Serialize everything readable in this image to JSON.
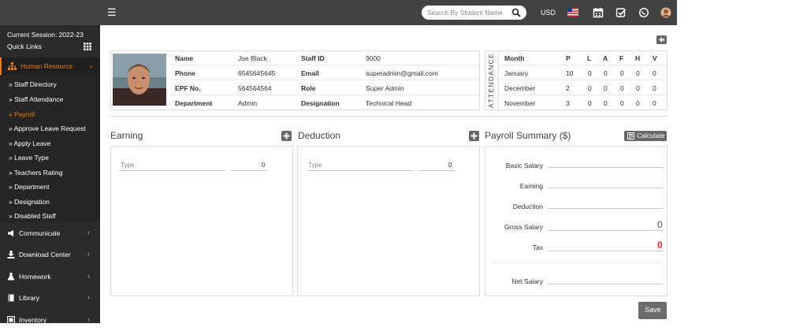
{
  "header": {
    "search_placeholder": "Search By Student Name",
    "currency": "USD"
  },
  "sidebar": {
    "session": "Current Session: 2022-23",
    "quick_links": "Quick Links",
    "active_section": "Human Resource",
    "sub_items": [
      "» Staff Directory",
      "» Staff Attendance",
      "» Payroll",
      "» Approve Leave Request",
      "» Apply Leave",
      "» Leave Type",
      "» Teachers Rating",
      "» Department",
      "» Designation",
      "» Disabled Staff"
    ],
    "menus": [
      "Communicate",
      "Download Center",
      "Homework",
      "Library",
      "Inventory"
    ]
  },
  "staff": {
    "name_label": "Name",
    "name": "Joe Black",
    "phone_label": "Phone",
    "phone": "6545645645",
    "epf_label": "EPF No.",
    "epf": "564564564",
    "department_label": "Department",
    "department": "Admin",
    "staffid_label": "Staff ID",
    "staffid": "9000",
    "email_label": "Email",
    "email": "superadmin@gmail.com",
    "role_label": "Role",
    "role": "Super Admin",
    "designation_label": "Designation",
    "designation": "Technical Head"
  },
  "attendance": {
    "vertical_label": "ATTENDANCE",
    "headers": [
      "Month",
      "P",
      "L",
      "A",
      "F",
      "H",
      "V"
    ],
    "rows": [
      [
        "January",
        "10",
        "0",
        "0",
        "0",
        "0",
        "0"
      ],
      [
        "December",
        "2",
        "0",
        "0",
        "0",
        "0",
        "0"
      ],
      [
        "November",
        "3",
        "0",
        "0",
        "0",
        "0",
        "0"
      ]
    ]
  },
  "earning": {
    "title": "Earning",
    "type_placeholder": "Type",
    "amount": "0"
  },
  "deduction": {
    "title": "Deduction",
    "type_placeholder": "Type",
    "amount": "0"
  },
  "summary": {
    "title": "Payroll Summary ($)",
    "calculate": "Calculate",
    "basic_salary": "Basic Salary",
    "earning": "Earning",
    "deduction": "Deduction",
    "gross_salary": "Gross Salary",
    "gross_value": "0",
    "tax": "Tax",
    "tax_value": "0",
    "net_salary": "Net Salary"
  },
  "save": "Save"
}
